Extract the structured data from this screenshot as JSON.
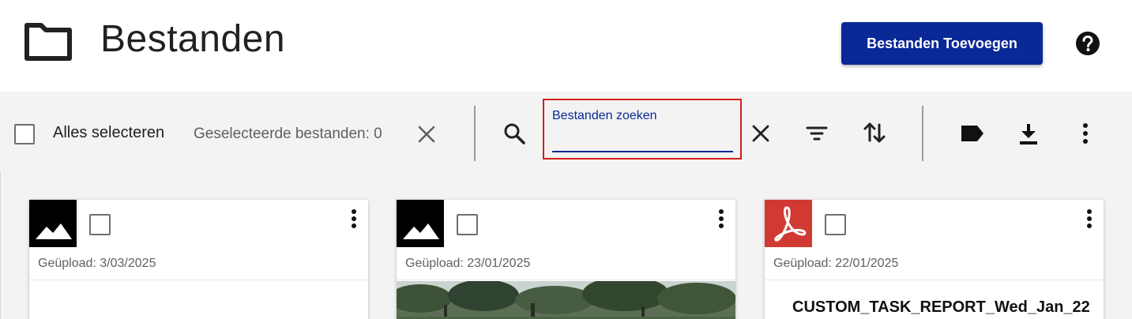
{
  "header": {
    "title": "Bestanden",
    "add_button_label": "Bestanden Toevoegen",
    "icons": {
      "folder": "folder-icon",
      "help": "help-icon"
    }
  },
  "toolbar": {
    "select_all_label": "Alles selecteren",
    "selected_count_label": "Geselecteerde bestanden: 0",
    "search": {
      "label": "Bestanden zoeken",
      "value": ""
    },
    "icons": [
      "close-icon",
      "search-icon",
      "filter-icon",
      "sort-icon",
      "tag-icon",
      "download-icon",
      "more-vert-icon"
    ]
  },
  "colors": {
    "primary": "#0a2896",
    "search_highlight": "#d21e1e",
    "pdf_red": "#d13a32",
    "toolbar_bg": "#f3f3f3"
  },
  "files": [
    {
      "type": "image",
      "thumb_icon": "image-icon",
      "uploaded": "Geüpload: 3/03/2025",
      "name": ""
    },
    {
      "type": "image",
      "thumb_icon": "image-icon",
      "uploaded": "Geüpload: 23/01/2025",
      "name": ""
    },
    {
      "type": "pdf",
      "thumb_icon": "pdf-icon",
      "uploaded": "Geüpload: 22/01/2025",
      "name": "CUSTOM_TASK_REPORT_Wed_Jan_22"
    }
  ]
}
